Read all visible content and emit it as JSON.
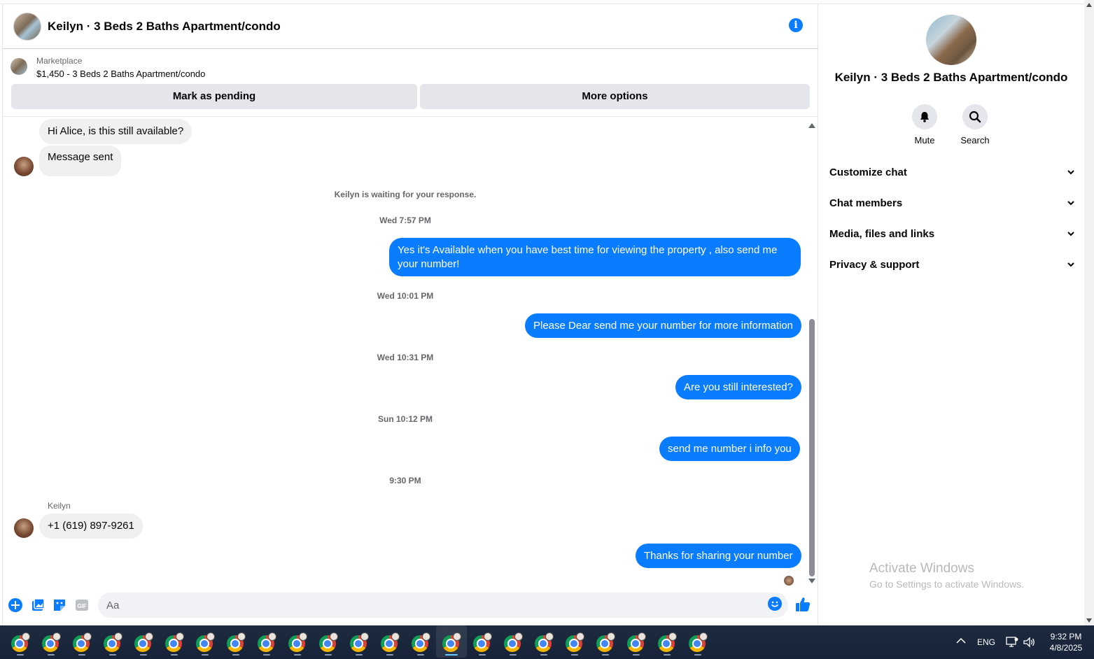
{
  "header": {
    "title": "Keilyn · 3 Beds 2 Baths Apartment/condo"
  },
  "marketplace": {
    "label": "Marketplace",
    "listing": "$1,450 - 3 Beds 2 Baths Apartment/condo",
    "mark_pending": "Mark as pending",
    "more_options": "More options"
  },
  "messages": [
    {
      "text": "Hi Alice, is this still available?"
    },
    {
      "text": "Message sent"
    },
    {
      "text": "Yes it's Available when you have best time for viewing the property , also send me your number!"
    },
    {
      "text": "Please Dear send me your number for more information"
    },
    {
      "text": "Are you still interested?"
    },
    {
      "text": "send me number i info you"
    },
    {
      "text": "+1 (619) 897-9261"
    },
    {
      "text": "Thanks for sharing your number"
    }
  ],
  "system_message": "Keilyn is waiting for your response.",
  "timestamps": [
    "Wed 7:57 PM",
    "Wed 10:01 PM",
    "Wed 10:31 PM",
    "Sun 10:12 PM",
    "9:30 PM"
  ],
  "sender_name": "Keilyn",
  "composer": {
    "placeholder": "Aa"
  },
  "sidebar": {
    "title": "Keilyn · 3 Beds 2 Baths Apartment/condo",
    "mute_label": "Mute",
    "search_label": "Search",
    "sections": [
      "Customize chat",
      "Chat members",
      "Media, files and links",
      "Privacy & support"
    ]
  },
  "watermark": {
    "line1": "Activate Windows",
    "line2": "Go to Settings to activate Windows."
  },
  "taskbar": {
    "language": "ENG",
    "time": "9:32 PM",
    "date": "4/8/2025"
  },
  "colors": {
    "accent": "#0a7cff",
    "incoming_bubble": "#f0f0f0",
    "button_bg": "#e4e6eb",
    "taskbar": "#1c2a3a"
  }
}
